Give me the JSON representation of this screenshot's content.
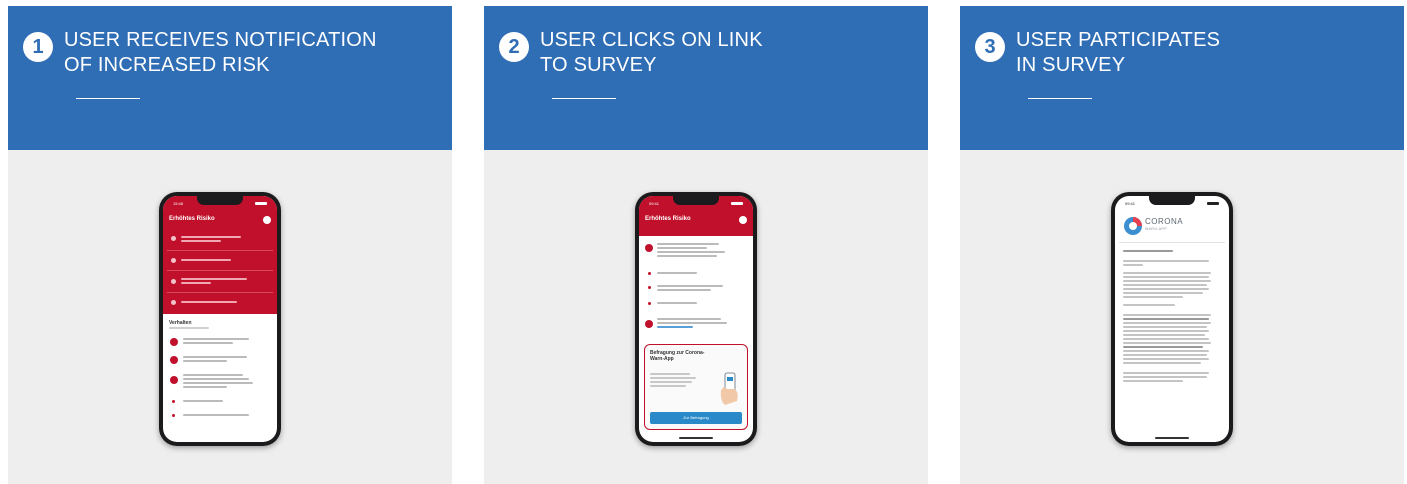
{
  "steps": [
    {
      "number": "1",
      "title": "USER RECEIVES NOTIFICATION\nOF INCREASED RISK"
    },
    {
      "number": "2",
      "title": "USER CLICKS ON LINK\nTO SURVEY"
    },
    {
      "number": "3",
      "title": "USER PARTICIPATES\nIN SURVEY"
    }
  ],
  "colors": {
    "header": "#2f6db5",
    "panel": "#eeeeee",
    "app_red": "#c0102b",
    "button_blue": "#2a89c9"
  },
  "phone1": {
    "app_title": "Erhöhtes Risiko",
    "subheading": "Verhalten"
  },
  "phone2": {
    "app_title": "Erhöhtes Risiko",
    "survey_title": "Befragung zur Corona-Warn-App",
    "survey_button": "Zur Befragung"
  },
  "phone3": {
    "logo_text": "CORONA",
    "logo_sub": "WARN-APP"
  }
}
